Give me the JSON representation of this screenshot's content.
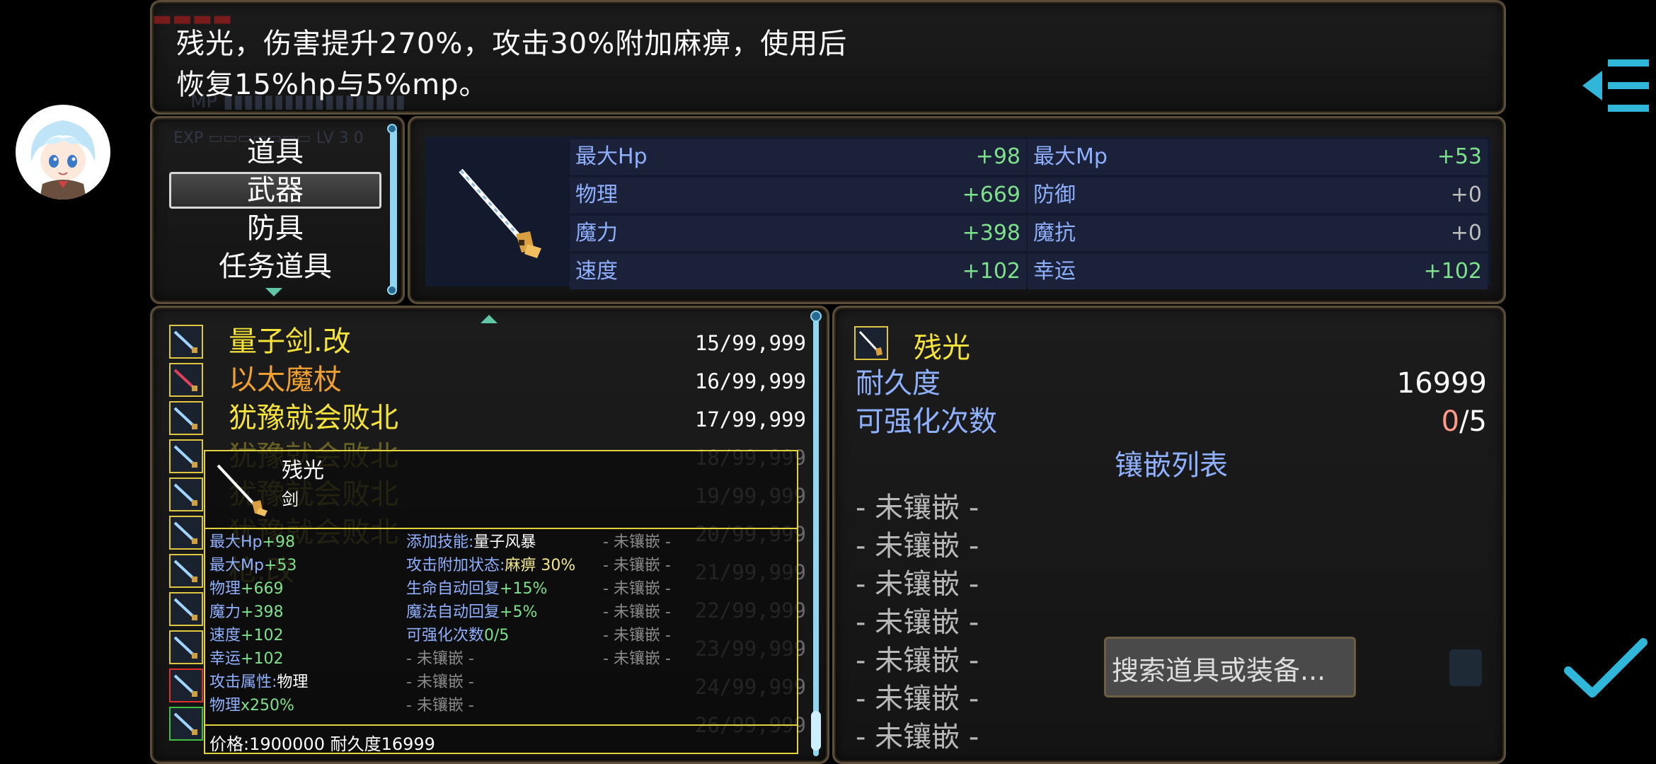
{
  "help": {
    "line1": "残光，伤害提升270%，攻击30%附加麻痹，使用后",
    "line2": "恢复15%hp与5%mp。"
  },
  "categories": {
    "items": [
      "道具",
      "武器",
      "防具",
      "任务道具"
    ],
    "selected_index": 1
  },
  "status": {
    "rows": [
      {
        "left_label": "最大Hp",
        "left_value": "+98",
        "right_label": "最大Mp",
        "right_value": "+53"
      },
      {
        "left_label": "物理",
        "left_value": "+669",
        "right_label": "防御",
        "right_value": "+0"
      },
      {
        "left_label": "魔力",
        "left_value": "+398",
        "right_label": "魔抗",
        "right_value": "+0"
      },
      {
        "left_label": "速度",
        "left_value": "+102",
        "right_label": "幸运",
        "right_value": "+102"
      }
    ]
  },
  "item_list": {
    "items": [
      {
        "name": "量子剑.改",
        "qty": "15/99,999",
        "color": "#f5e33a"
      },
      {
        "name": "以太魔杖",
        "qty": "16/99,999",
        "color": "#f0a030"
      },
      {
        "name": "犹豫就会败北",
        "qty": "17/99,999",
        "color": "#f5e33a"
      },
      {
        "name": "犹豫就会败北",
        "qty": "18/99,999",
        "color": "#f5e33a"
      },
      {
        "name": "犹豫就会败北",
        "qty": "19/99,999",
        "color": "#f5e33a"
      },
      {
        "name": "犹豫就会败北",
        "qty": "20/99,999",
        "color": "#f5e33a"
      },
      {
        "name": "枪.改",
        "qty": "21/99,999",
        "color": "#f5e33a"
      },
      {
        "name": "",
        "qty": "22/99,999",
        "color": "#f5e33a"
      },
      {
        "name": "",
        "qty": "23/99,999",
        "color": "#f5e33a"
      },
      {
        "name": "",
        "qty": "24/99,999",
        "color": "#e04040"
      },
      {
        "name": "",
        "qty": "26/99,999",
        "color": "#5ac85a"
      }
    ]
  },
  "tooltip": {
    "name": "残光",
    "type": "剑",
    "col1": [
      {
        "label": "最大Hp",
        "value": "+98"
      },
      {
        "label": "最大Mp",
        "value": "+53"
      },
      {
        "label": "物理",
        "value": "+669"
      },
      {
        "label": "魔力",
        "value": "+398"
      },
      {
        "label": "速度",
        "value": "+102"
      },
      {
        "label": "幸运",
        "value": "+102"
      },
      {
        "label": "攻击属性:",
        "value": "物理"
      },
      {
        "label": "物理",
        "value": "x250%"
      }
    ],
    "col2": [
      {
        "label": "添加技能:",
        "value": "量子风暴"
      },
      {
        "label": "攻击附加状态:",
        "value": "麻痹 30%"
      },
      {
        "label": "生命自动回复",
        "value": "+15%"
      },
      {
        "label": "魔法自动回复",
        "value": "+5%"
      },
      {
        "label": "可强化次数",
        "value": "0/5"
      },
      {
        "label": "- 未镶嵌 -",
        "value": ""
      },
      {
        "label": "- 未镶嵌 -",
        "value": ""
      },
      {
        "label": "- 未镶嵌 -",
        "value": ""
      }
    ],
    "col3": [
      "- 未镶嵌 -",
      "- 未镶嵌 -",
      "- 未镶嵌 -",
      "- 未镶嵌 -",
      "- 未镶嵌 -",
      "- 未镶嵌 -"
    ],
    "footer": "价格:1900000 耐久度16999"
  },
  "detail": {
    "name": "残光",
    "durability_label": "耐久度",
    "durability_value": "16999",
    "enhance_label": "可强化次数",
    "enhance_current": "0",
    "enhance_max": "/5",
    "socket_title": "镶嵌列表",
    "sockets": [
      "- 未镶嵌 -",
      "- 未镶嵌 -",
      "- 未镶嵌 -",
      "- 未镶嵌 -",
      "- 未镶嵌 -",
      "- 未镶嵌 -",
      "- 未镶嵌 -"
    ]
  },
  "search": {
    "placeholder": "搜索道具或装备..."
  },
  "colors": {
    "accent": "#8fd6f2",
    "gold": "#f5e33a",
    "bonus": "#7de08b",
    "label": "#8fb0ff"
  }
}
